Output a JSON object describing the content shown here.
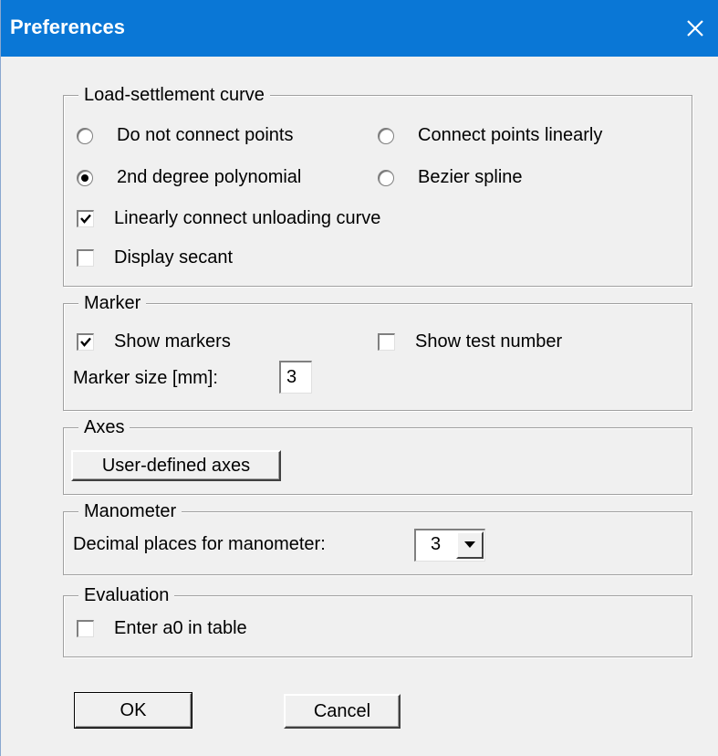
{
  "window": {
    "title": "Preferences",
    "close_icon": "close-icon"
  },
  "load_curve": {
    "label": "Load-settlement curve",
    "options": [
      {
        "label": "Do not connect points",
        "checked": false
      },
      {
        "label": "Connect points linearly",
        "checked": false
      },
      {
        "label": "2nd degree polynomial",
        "checked": true
      },
      {
        "label": "Bezier spline",
        "checked": false
      }
    ],
    "unloading_label": "Linearly connect unloading curve",
    "unloading_checked": true,
    "secant_label": "Display secant",
    "secant_checked": false
  },
  "marker": {
    "label": "Marker",
    "show_markers_label": "Show markers",
    "show_markers_checked": true,
    "show_test_number_label": "Show test number",
    "show_test_number_checked": false,
    "size_label": "Marker size [mm]:",
    "size_value": "3"
  },
  "axes": {
    "label": "Axes",
    "button_label": "User-defined axes"
  },
  "manometer": {
    "label": "Manometer",
    "decimals_label": "Decimal places for manometer:",
    "decimals_value": "3"
  },
  "evaluation": {
    "label": "Evaluation",
    "a0_label": "Enter a0 in table",
    "a0_checked": false
  },
  "footer": {
    "ok_label": "OK",
    "cancel_label": "Cancel"
  }
}
